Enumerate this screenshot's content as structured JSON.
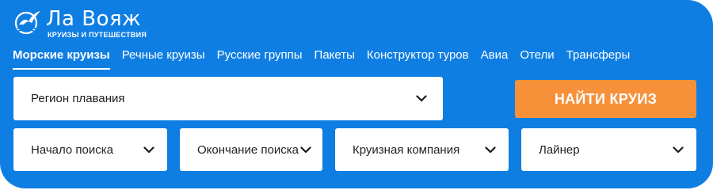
{
  "logo": {
    "name": "Ла Вояж",
    "tagline": "КРУИЗЫ И ПУТЕШЕСТВИЯ"
  },
  "tabs": [
    {
      "label": "Морские круизы",
      "active": true
    },
    {
      "label": "Речные круизы"
    },
    {
      "label": "Русские группы"
    },
    {
      "label": "Пакеты"
    },
    {
      "label": "Конструктор туров"
    },
    {
      "label": "Авиа"
    },
    {
      "label": "Отели"
    },
    {
      "label": "Трансферы"
    }
  ],
  "search": {
    "region": "Регион плавания",
    "start": "Начало поиска",
    "end": "Окончание поиска",
    "company": "Круизная компания",
    "ship": "Лайнер",
    "submit": "НАЙТИ КРУИЗ"
  },
  "colors": {
    "background": "#0f7ee3",
    "button": "#f6913a"
  },
  "icons": {
    "dropdown": "chevron-down-icon",
    "logo": "seagull-logo-icon"
  }
}
